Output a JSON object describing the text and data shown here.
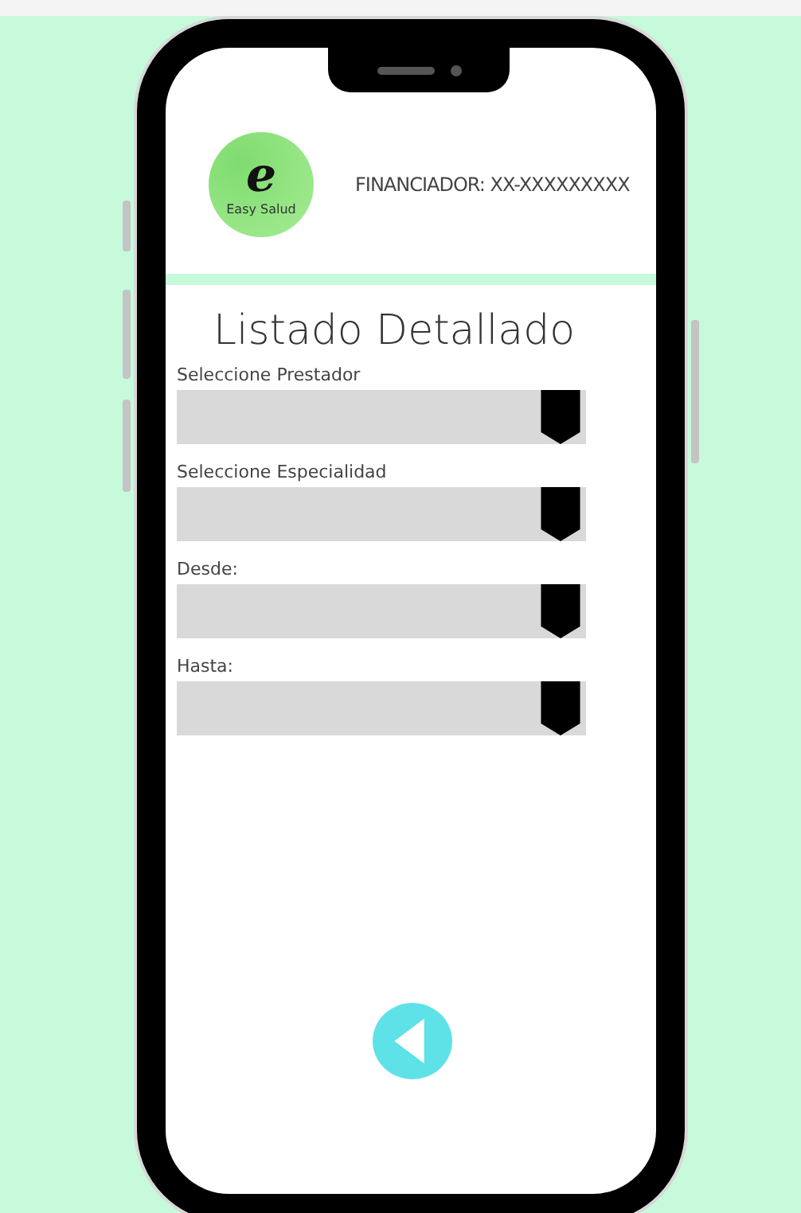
{
  "header": {
    "logo_letter": "e",
    "logo_name": "Easy Salud",
    "financiador": "FINANCIADOR: XX-XXXXXXXXX"
  },
  "title": "Listado Detallado",
  "fields": [
    {
      "label": "Seleccione Prestador"
    },
    {
      "label": "Seleccione Especialidad"
    },
    {
      "label": "Desde:"
    },
    {
      "label": "Hasta:"
    }
  ]
}
